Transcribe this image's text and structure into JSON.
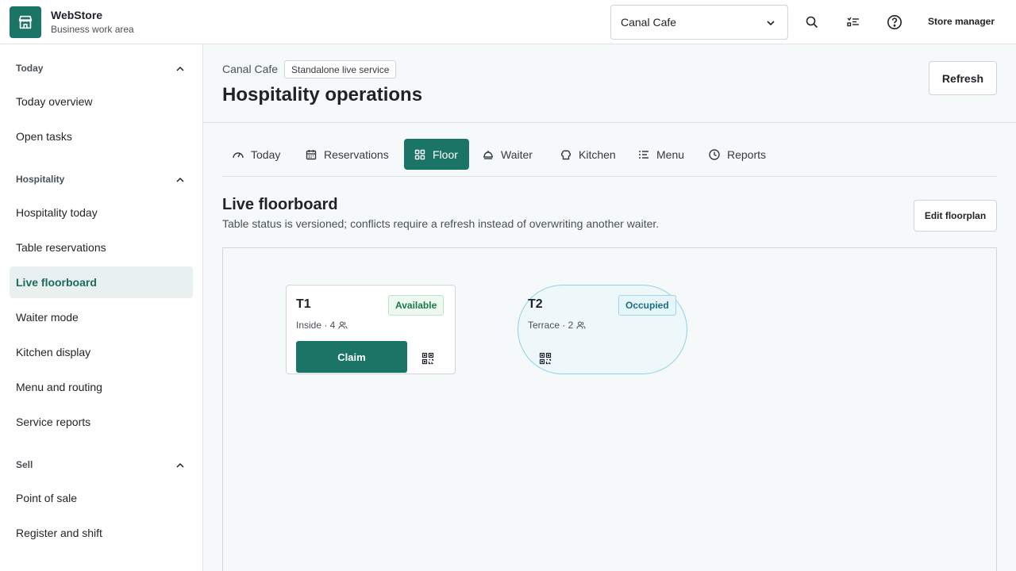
{
  "header": {
    "app_name": "WebStore",
    "app_subtitle": "Business work area",
    "store_selected": "Canal Cafe",
    "user_label": "Store manager",
    "icons": [
      "store-icon",
      "chevron-down-icon",
      "search-icon",
      "checklist-icon",
      "help-icon"
    ]
  },
  "sidebar": {
    "sections": [
      {
        "label": "Today",
        "items": [
          "Today overview",
          "Open tasks"
        ]
      },
      {
        "label": "Hospitality",
        "items": [
          "Hospitality today",
          "Table reservations",
          "Live floorboard",
          "Waiter mode",
          "Kitchen display",
          "Menu and routing",
          "Service reports"
        ]
      },
      {
        "label": "Sell",
        "items": [
          "Point of sale",
          "Register and shift"
        ]
      }
    ],
    "active_item": "Live floorboard"
  },
  "page": {
    "breadcrumb": "Canal Cafe",
    "mode_badge": "Standalone live service",
    "title": "Hospitality operations",
    "refresh_label": "Refresh"
  },
  "tabs": [
    {
      "label": "Today",
      "icon": "gauge-icon"
    },
    {
      "label": "Reservations",
      "icon": "calendar-icon"
    },
    {
      "label": "Floor",
      "icon": "grid-icon",
      "active": true
    },
    {
      "label": "Waiter",
      "icon": "cloche-icon"
    },
    {
      "label": "Kitchen",
      "icon": "chef-hat-icon"
    },
    {
      "label": "Menu",
      "icon": "list-icon"
    },
    {
      "label": "Reports",
      "icon": "clock-icon"
    }
  ],
  "floorboard": {
    "title": "Live floorboard",
    "description": "Table status is versioned; conflicts require a refresh instead of overwriting another waiter.",
    "edit_label": "Edit floorplan",
    "tables": [
      {
        "name": "T1",
        "status": "Available",
        "area": "Inside",
        "seats": "4",
        "meta": "Inside · 4",
        "action": "Claim",
        "shape": "rectangle"
      },
      {
        "name": "T2",
        "status": "Occupied",
        "area": "Terrace",
        "seats": "2",
        "meta": "Terrace · 2",
        "shape": "round"
      }
    ]
  },
  "colors": {
    "accent": "#1a7566",
    "available": "#1a7a45",
    "occupied": "#176f86"
  }
}
